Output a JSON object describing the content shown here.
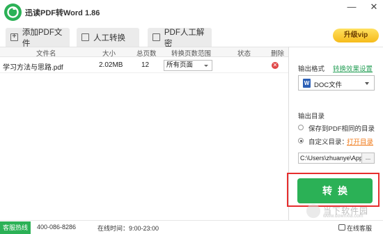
{
  "window": {
    "title": "迅读PDF转Word 1.86",
    "minimize_glyph": "—",
    "close_glyph": "✕"
  },
  "toolbar": {
    "add_pdf_label": "添加PDF文件",
    "manual_convert_label": "人工转换",
    "manual_decrypt_label": "PDF人工解密",
    "upgrade_label": "升级vip"
  },
  "table": {
    "headers": [
      "文件名",
      "大小",
      "总页数",
      "转换页数范围",
      "状态",
      "删除"
    ],
    "rows": [
      {
        "filename": "学习方法与思路.pdf",
        "size": "2.02MB",
        "pages": "12",
        "range": "所有页面",
        "status": ""
      }
    ]
  },
  "settings": {
    "output_format_label": "输出格式",
    "effect_settings_link": "转换效果设置",
    "format_value": "DOC文件",
    "output_dir_label": "输出目录",
    "option_same_dir": "保存到PDF相同的目录",
    "option_custom_dir": "自定义目录：",
    "open_dir_link": "打开目录",
    "path_value": "C:\\Users\\zhuanye\\AppD",
    "browse_label": "...",
    "convert_label": "转换"
  },
  "statusbar": {
    "hotline_label": "客服热线",
    "phone": "400-086-8286",
    "hours": "在线时间：9:00-23:00",
    "online_service": "在线客服"
  },
  "watermark": {
    "text": "当下软件园",
    "url": "www.downxia.com"
  },
  "colors": {
    "brand_green": "#2bb156",
    "highlight_red": "#e62e2e",
    "upgrade_gold": "#f6bb1a"
  }
}
